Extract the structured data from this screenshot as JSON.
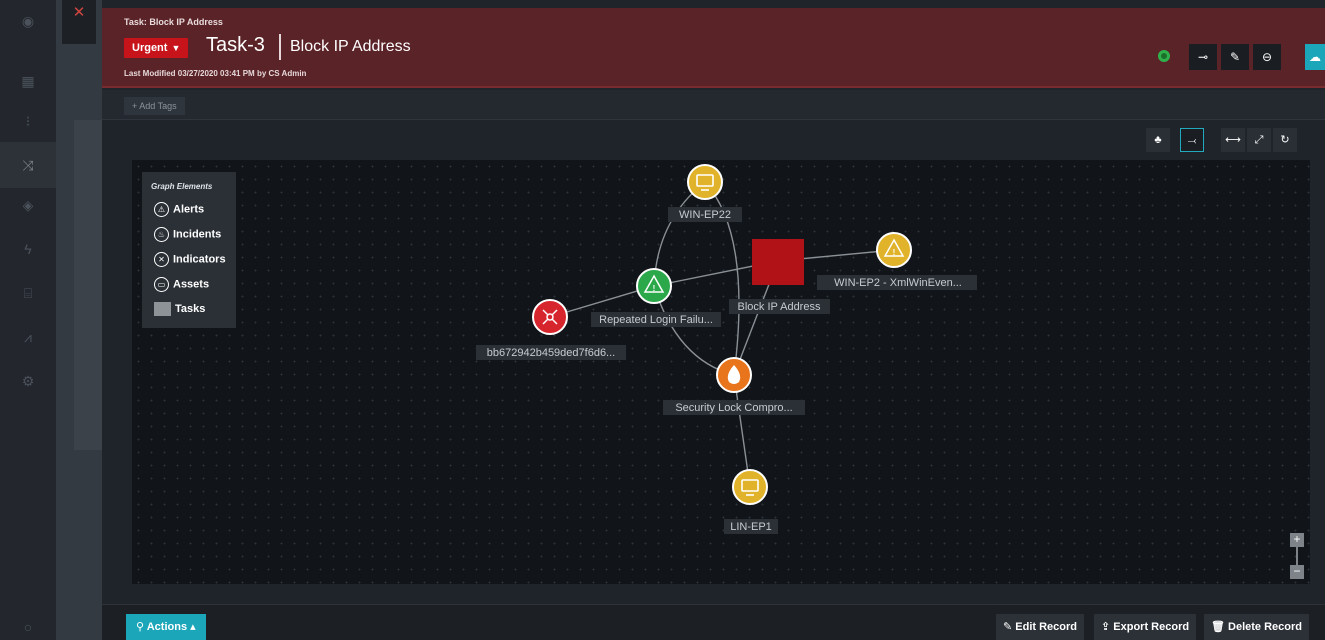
{
  "header": {
    "crumb": "Task: Block IP Address",
    "priority": "Urgent",
    "task_id": "Task-3",
    "title": "Block IP Address",
    "last_modified": "Last Modified 03/27/2020 03:41 PM by CS Admin"
  },
  "tags": {
    "add_label": "+ Add Tags"
  },
  "legend": {
    "title": "Graph Elements",
    "items": [
      "Alerts",
      "Incidents",
      "Indicators",
      "Assets",
      "Tasks"
    ]
  },
  "graph": {
    "nodes": [
      {
        "id": "winep22",
        "label": "WIN-EP22",
        "type": "asset",
        "color": "#e0b32a"
      },
      {
        "id": "blockip",
        "label": "Block IP Address",
        "type": "task",
        "color": "#b01218"
      },
      {
        "id": "winep2",
        "label": "WIN-EP2 - XmlWinEven...",
        "type": "alert",
        "color": "#e0b32a"
      },
      {
        "id": "repeated",
        "label": "Repeated Login Failu...",
        "type": "alert",
        "color": "#2aa84a"
      },
      {
        "id": "bb672",
        "label": "bb672942b459ded7f6d6...",
        "type": "indicator",
        "color": "#d7252e"
      },
      {
        "id": "seclock",
        "label": "Security Lock Compro...",
        "type": "incident",
        "color": "#e8741c"
      },
      {
        "id": "linep1",
        "label": "LIN-EP1",
        "type": "asset",
        "color": "#e0b32a"
      }
    ]
  },
  "footer": {
    "actions": "Actions",
    "edit": "Edit Record",
    "export": "Export Record",
    "delete": "Delete Record"
  },
  "colors": {
    "accent": "#1ba6b9",
    "header_bg": "#5a2328",
    "urgent": "#c7141b"
  }
}
